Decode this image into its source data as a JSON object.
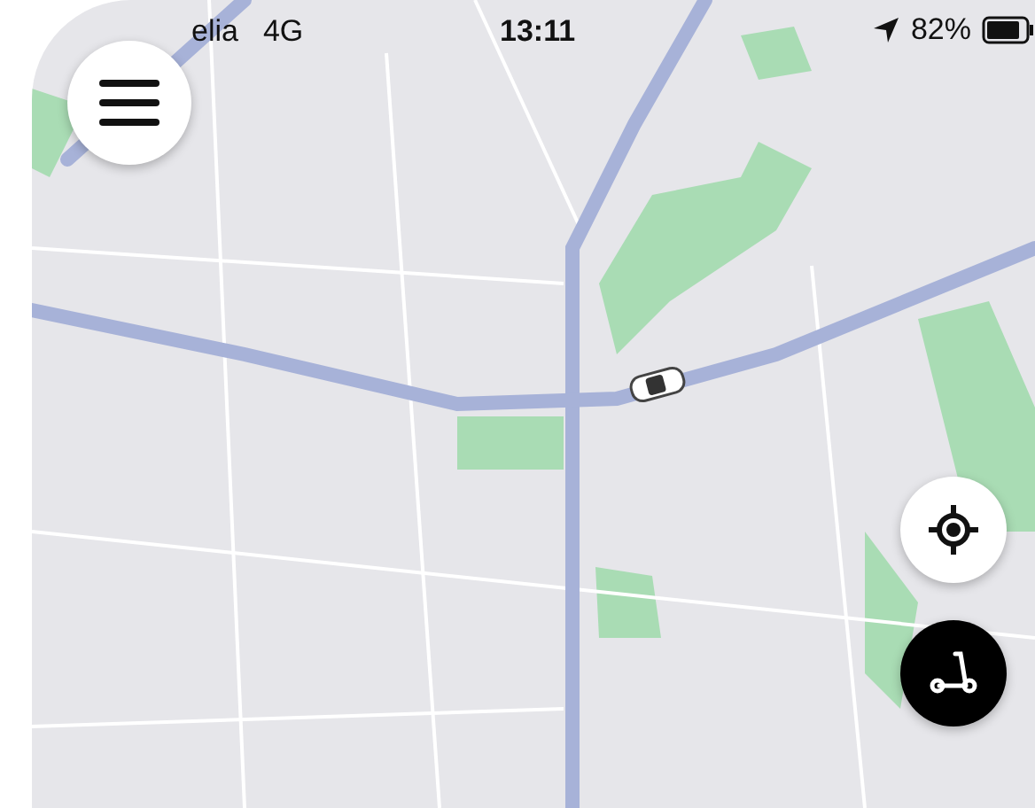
{
  "status_bar": {
    "carrier": "elia",
    "network": "4G",
    "time": "13:11",
    "battery": "82%"
  },
  "buttons": [
    {
      "kind": "menu"
    },
    {
      "kind": "locate"
    },
    {
      "kind": "scooter"
    }
  ]
}
